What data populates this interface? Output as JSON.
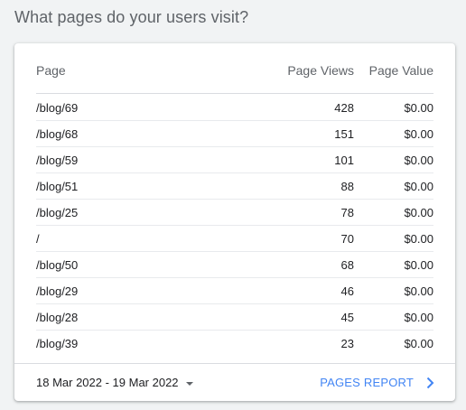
{
  "title": "What pages do your users visit?",
  "table": {
    "headers": {
      "page": "Page",
      "views": "Page Views",
      "value": "Page Value"
    },
    "rows": [
      {
        "page": "/blog/69",
        "views": "428",
        "value": "$0.00"
      },
      {
        "page": "/blog/68",
        "views": "151",
        "value": "$0.00"
      },
      {
        "page": "/blog/59",
        "views": "101",
        "value": "$0.00"
      },
      {
        "page": "/blog/51",
        "views": "88",
        "value": "$0.00"
      },
      {
        "page": "/blog/25",
        "views": "78",
        "value": "$0.00"
      },
      {
        "page": "/",
        "views": "70",
        "value": "$0.00"
      },
      {
        "page": "/blog/50",
        "views": "68",
        "value": "$0.00"
      },
      {
        "page": "/blog/29",
        "views": "46",
        "value": "$0.00"
      },
      {
        "page": "/blog/28",
        "views": "45",
        "value": "$0.00"
      },
      {
        "page": "/blog/39",
        "views": "23",
        "value": "$0.00"
      }
    ]
  },
  "footer": {
    "date_range": "18 Mar 2022 - 19 Mar 2022",
    "report_link": "PAGES REPORT"
  },
  "colors": {
    "accent": "#4285f4",
    "background": "#f1f3f4"
  },
  "icons": {
    "date_dropdown": "caret-down-icon",
    "report": "chevron-right-icon"
  }
}
